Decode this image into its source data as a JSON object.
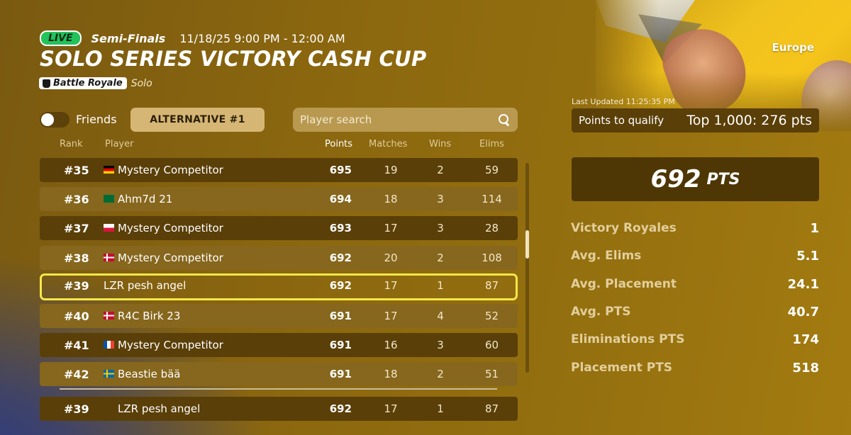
{
  "event": {
    "live_label": "LIVE",
    "phase": "Semi-Finals",
    "datetime": "11/18/25 9:00 PM - 12:00 AM",
    "title": "SOLO SERIES VICTORY CASH CUP",
    "mode_badge": "Battle Royale",
    "mode_sub": "Solo",
    "region": "Europe"
  },
  "controls": {
    "friends_label": "Friends",
    "friends_toggle_on": false,
    "alternative_label": "ALTERNATIVE #1",
    "search_placeholder": "Player search"
  },
  "table": {
    "headers": {
      "rank": "Rank",
      "player": "Player",
      "points": "Points",
      "matches": "Matches",
      "wins": "Wins",
      "elims": "Elims"
    },
    "rows": [
      {
        "rank": "#35",
        "flag": "de",
        "player": "Mystery Competitor",
        "points": "695",
        "matches": "19",
        "wins": "2",
        "elims": "59"
      },
      {
        "rank": "#36",
        "flag": "sa",
        "player": "Ahm7d 21",
        "points": "694",
        "matches": "18",
        "wins": "3",
        "elims": "114"
      },
      {
        "rank": "#37",
        "flag": "pl",
        "player": "Mystery Competitor",
        "points": "693",
        "matches": "17",
        "wins": "3",
        "elims": "28"
      },
      {
        "rank": "#38",
        "flag": "dk",
        "player": "Mystery Competitor",
        "points": "692",
        "matches": "20",
        "wins": "2",
        "elims": "108"
      },
      {
        "rank": "#39",
        "flag": "",
        "player": "LZR pesh angel",
        "points": "692",
        "matches": "17",
        "wins": "1",
        "elims": "87",
        "highlight": true
      },
      {
        "rank": "#40",
        "flag": "dk",
        "player": "R4C Birk 23",
        "points": "691",
        "matches": "17",
        "wins": "4",
        "elims": "52"
      },
      {
        "rank": "#41",
        "flag": "fr",
        "player": "Mystery Competitor",
        "points": "691",
        "matches": "16",
        "wins": "3",
        "elims": "60"
      },
      {
        "rank": "#42",
        "flag": "se",
        "player": "Beastie bää",
        "points": "691",
        "matches": "18",
        "wins": "2",
        "elims": "51"
      }
    ],
    "pinned": {
      "rank": "#39",
      "player": "LZR pesh angel",
      "points": "692",
      "matches": "17",
      "wins": "1",
      "elims": "87"
    }
  },
  "panel": {
    "last_updated": "Last Updated 11:25:35 PM",
    "qualify_label": "Points to qualify",
    "qualify_value": "Top 1,000: 276 pts",
    "big_points": "692",
    "big_unit": "PTS",
    "stats": [
      {
        "label": "Victory Royales",
        "value": "1"
      },
      {
        "label": "Avg. Elims",
        "value": "5.1"
      },
      {
        "label": "Avg. Placement",
        "value": "24.1"
      },
      {
        "label": "Avg. PTS",
        "value": "40.7"
      },
      {
        "label": "Eliminations PTS",
        "value": "174"
      },
      {
        "label": "Placement PTS",
        "value": "518"
      }
    ]
  },
  "colors": {
    "live_green": "#23c25b",
    "highlight_border": "#f6e84a",
    "row_dark": "#5a3f08",
    "row_light": "#86671d"
  }
}
